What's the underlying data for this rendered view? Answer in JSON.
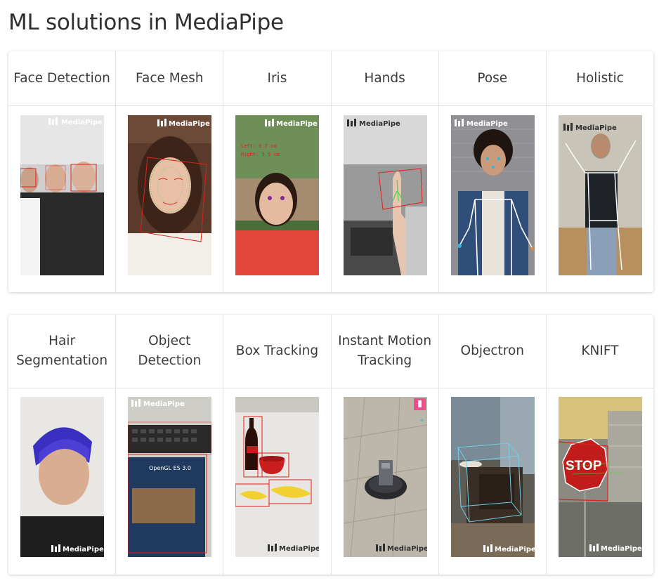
{
  "page": {
    "title": "ML solutions in MediaPipe"
  },
  "watermark": "MediaPipe",
  "colors": {
    "overlay_red": "#e0201b",
    "overlay_green": "#4fd14a",
    "overlay_white": "#ffffff",
    "card_border": "#e4e4e4"
  },
  "rows": [
    {
      "solutions": [
        {
          "name": "Face Detection",
          "icon": "face-detection-demo"
        },
        {
          "name": "Face Mesh",
          "icon": "face-mesh-demo"
        },
        {
          "name": "Iris",
          "icon": "iris-demo"
        },
        {
          "name": "Hands",
          "icon": "hands-demo"
        },
        {
          "name": "Pose",
          "icon": "pose-demo"
        },
        {
          "name": "Holistic",
          "icon": "holistic-demo"
        }
      ]
    },
    {
      "solutions": [
        {
          "name": "Hair Segmentation",
          "icon": "hair-segmentation-demo"
        },
        {
          "name": "Object Detection",
          "icon": "object-detection-demo"
        },
        {
          "name": "Box Tracking",
          "icon": "box-tracking-demo"
        },
        {
          "name": "Instant Motion Tracking",
          "icon": "instant-motion-tracking-demo"
        },
        {
          "name": "Objectron",
          "icon": "objectron-demo"
        },
        {
          "name": "KNIFT",
          "icon": "knift-demo"
        }
      ]
    }
  ]
}
